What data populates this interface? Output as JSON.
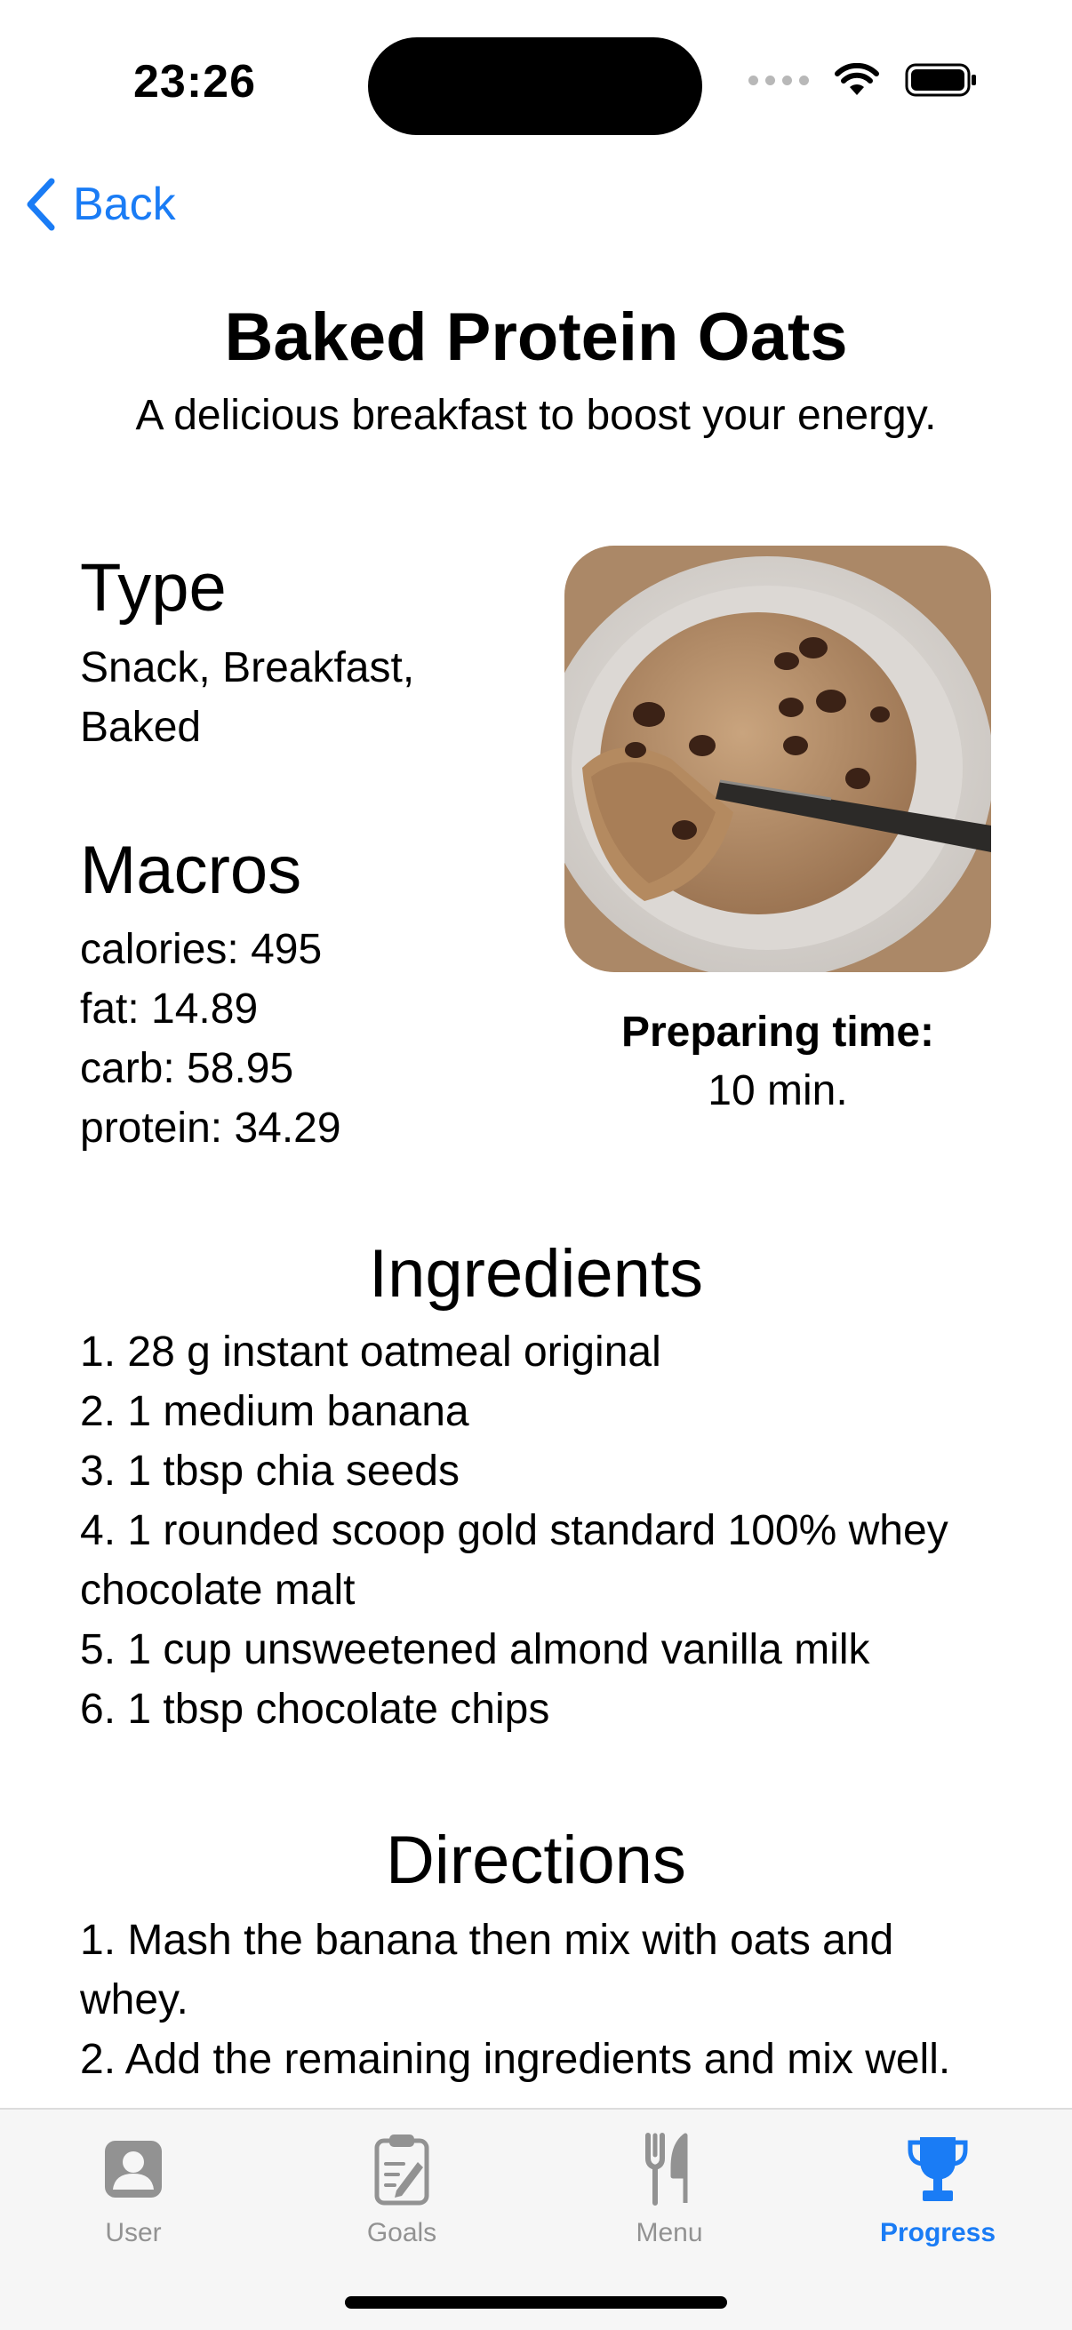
{
  "status_bar": {
    "time": "23:26"
  },
  "nav": {
    "back_label": "Back"
  },
  "recipe": {
    "title": "Baked Protein Oats",
    "subtitle": "A delicious breakfast to boost your energy.",
    "type_heading": "Type",
    "type_value": "Snack, Breakfast, Baked",
    "macros_heading": "Macros",
    "macros": [
      "calories: 495",
      "fat: 14.89",
      "carb: 58.95",
      "protein: 34.29"
    ],
    "prep_label": "Preparing time:",
    "prep_value": "10 min.",
    "ingredients_heading": "Ingredients",
    "ingredients": [
      "1. 28 g instant oatmeal original",
      "2. 1 medium banana",
      "3. 1 tbsp chia seeds",
      "4. 1 rounded scoop gold standard 100% whey chocolate malt",
      "5. 1 cup unsweetened almond vanilla milk",
      "6. 1 tbsp chocolate chips"
    ],
    "directions_heading": "Directions",
    "directions": [
      "1. Mash the banana then mix with oats and whey.",
      "2. Add the remaining ingredients and mix well."
    ]
  },
  "tabs": [
    {
      "label": "User",
      "icon": "person-icon"
    },
    {
      "label": "Goals",
      "icon": "clipboard-icon"
    },
    {
      "label": "Menu",
      "icon": "fork-knife-icon"
    },
    {
      "label": "Progress",
      "icon": "trophy-icon",
      "active": true
    }
  ],
  "colors": {
    "accent": "#1a7cf5",
    "tab_inactive": "#929292",
    "tabbar_bg": "#f6f6f6"
  }
}
